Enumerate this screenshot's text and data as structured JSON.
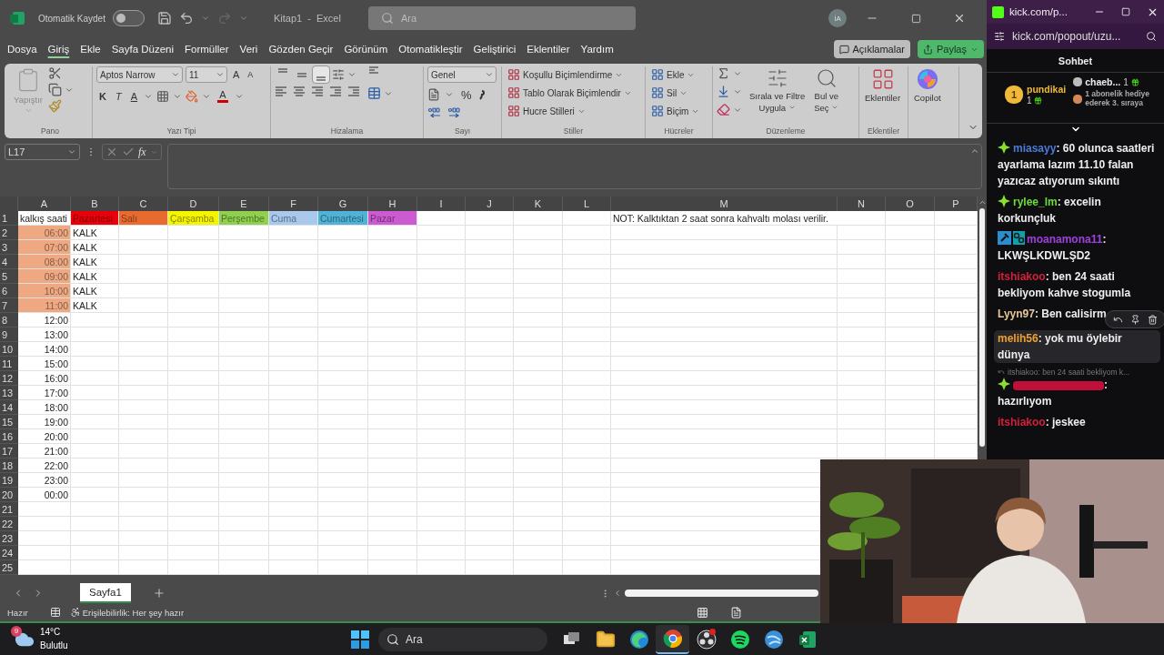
{
  "excel": {
    "title_bar": {
      "autosave_label": "Otomatik Kaydet",
      "autosave_on": false,
      "redo_disabled": true,
      "document_title": "Kitap1  -  Excel",
      "search": {
        "placeholder": "Ara"
      },
      "avatar": "İA"
    },
    "menu": {
      "tabs": [
        {
          "label": "Dosya",
          "selected": false
        },
        {
          "label": "Giriş",
          "selected": true
        },
        {
          "label": "Ekle",
          "selected": false
        },
        {
          "label": "Sayfa Düzeni",
          "selected": false
        },
        {
          "label": "Formüller",
          "selected": false
        },
        {
          "label": "Veri",
          "selected": false
        },
        {
          "label": "Gözden Geçir",
          "selected": false
        },
        {
          "label": "Görünüm",
          "selected": false
        },
        {
          "label": "Otomatikleştir",
          "selected": false
        },
        {
          "label": "Geliştirici",
          "selected": false
        },
        {
          "label": "Eklentiler",
          "selected": false
        },
        {
          "label": "Yardım",
          "selected": false
        }
      ],
      "buttons": [
        {
          "kind": "comments",
          "label": "Açıklamalar"
        },
        {
          "kind": "share",
          "label": "Paylaş"
        }
      ]
    },
    "ribbon": {
      "groups": [
        {
          "kind": "clipboard",
          "name": "Pano",
          "paste": {
            "label": "Yapıştır",
            "disabled": true
          }
        },
        {
          "kind": "font",
          "name": "Yazı Tipi",
          "font": "Aptos Narrow",
          "size": "11",
          "grow": "A",
          "shrink": "A",
          "bold": "K",
          "italic": "T",
          "underline": "A",
          "font_color": "A"
        },
        {
          "kind": "alignment",
          "name": "Hizalama",
          "vertical": [
            {
              "selected": false
            },
            {
              "selected": false
            },
            {
              "selected": true
            }
          ]
        },
        {
          "kind": "number",
          "name": "Sayı",
          "format": "Genel",
          "percent": "%"
        },
        {
          "kind": "styles",
          "name": "Stiller",
          "items": [
            "Koşullu Biçimlendirme",
            "Tablo Olarak Biçimlendir",
            "Hucre Stilleri"
          ]
        },
        {
          "kind": "cells",
          "name": "Hücreler",
          "items": [
            "Ekle",
            "Sil",
            "Biçim"
          ]
        },
        {
          "kind": "editing",
          "name": "Düzenleme",
          "sort": [
            "Sırala ve Filtre",
            "Uygula"
          ],
          "find": [
            "Bul ve",
            "Seç"
          ]
        },
        {
          "kind": "addins",
          "name": "Eklentiler",
          "button": "Eklentiler"
        },
        {
          "kind": "copilot",
          "button": "Copilot"
        }
      ]
    },
    "formula_bar": {
      "name_box": "L17",
      "function_label": "fx"
    },
    "sheet": {
      "columns": [
        "A",
        "B",
        "C",
        "D",
        "E",
        "F",
        "G",
        "H",
        "I",
        "J",
        "K",
        "L",
        "M",
        "N",
        "O",
        "P"
      ],
      "rows": [
        {
          "label": "1",
          "cells": {
            "A": {
              "text": "kalkış saati"
            },
            "B": {
              "text": "Pazartesi",
              "color": "#e8000b"
            },
            "C": {
              "text": "Salı",
              "color": "#e96a2f"
            },
            "D": {
              "text": "Çarşamba",
              "color": "#f5f500"
            },
            "E": {
              "text": "Perşembe",
              "color": "#8fd14f"
            },
            "F": {
              "text": "Cuma",
              "color": "#a8c8ec"
            },
            "G": {
              "text": "Cumartesi",
              "color": "#4fb3d9"
            },
            "H": {
              "text": "Pazar",
              "color": "#cc5ad0"
            },
            "M": {
              "kind": "note",
              "text": "NOT: Kalktıktan 2 saat sonra kahvaltı molası verilir."
            }
          }
        },
        {
          "label": "2",
          "cells": {
            "A": {
              "kind": "time",
              "text": "06:00",
              "color": "#eea882"
            },
            "B": {
              "text": "KALK"
            }
          }
        },
        {
          "label": "3",
          "cells": {
            "A": {
              "kind": "time",
              "text": "07:00",
              "color": "#eea882"
            },
            "B": {
              "text": "KALK"
            }
          }
        },
        {
          "label": "4",
          "cells": {
            "A": {
              "kind": "time",
              "text": "08:00",
              "color": "#eea882"
            },
            "B": {
              "text": "KALK"
            }
          }
        },
        {
          "label": "5",
          "cells": {
            "A": {
              "kind": "time",
              "text": "09:00",
              "color": "#eea882"
            },
            "B": {
              "text": "KALK"
            }
          }
        },
        {
          "label": "6",
          "cells": {
            "A": {
              "kind": "time",
              "text": "10:00",
              "color": "#eea882"
            },
            "B": {
              "text": "KALK"
            }
          }
        },
        {
          "label": "7",
          "cells": {
            "A": {
              "kind": "time",
              "text": "11:00",
              "color": "#eea882"
            },
            "B": {
              "text": "KALK"
            }
          }
        },
        {
          "label": "8",
          "cells": {
            "A": {
              "kind": "time",
              "text": "12:00"
            }
          }
        },
        {
          "label": "9",
          "cells": {
            "A": {
              "kind": "time",
              "text": "13:00"
            }
          }
        },
        {
          "label": "10",
          "cells": {
            "A": {
              "kind": "time",
              "text": "14:00"
            }
          }
        },
        {
          "label": "11",
          "cells": {
            "A": {
              "kind": "time",
              "text": "15:00"
            }
          }
        },
        {
          "label": "12",
          "cells": {
            "A": {
              "kind": "time",
              "text": "16:00"
            }
          }
        },
        {
          "label": "13",
          "cells": {
            "A": {
              "kind": "time",
              "text": "17:00"
            }
          }
        },
        {
          "label": "14",
          "cells": {
            "A": {
              "kind": "time",
              "text": "18:00"
            }
          }
        },
        {
          "label": "15",
          "cells": {
            "A": {
              "kind": "time",
              "text": "19:00"
            }
          }
        },
        {
          "label": "16",
          "cells": {
            "A": {
              "kind": "time",
              "text": "20:00"
            }
          }
        },
        {
          "label": "17",
          "cells": {
            "A": {
              "kind": "time",
              "text": "21:00"
            }
          }
        },
        {
          "label": "18",
          "cells": {
            "A": {
              "kind": "time",
              "text": "22:00"
            }
          }
        },
        {
          "label": "19",
          "cells": {
            "A": {
              "kind": "time",
              "text": "23:00"
            }
          }
        },
        {
          "label": "20",
          "cells": {
            "A": {
              "kind": "time",
              "text": "00:00"
            }
          }
        },
        {
          "label": "21"
        },
        {
          "label": "22"
        },
        {
          "label": "23"
        },
        {
          "label": "24"
        },
        {
          "label": "25"
        }
      ]
    },
    "sheet_tabs": [
      {
        "label": "Sayfa1",
        "selected": true
      }
    ],
    "status_bar": {
      "ready": "Hazır",
      "accessibility": "Erişilebilirlik: Her şey hazır"
    }
  },
  "chat": {
    "window_title": "kick.com/p...",
    "url": "kick.com/popout/uzu...",
    "header": "Sohbet",
    "leaders": [
      {
        "kind": "first",
        "rank": "1",
        "name": "pundikai",
        "count": "1"
      },
      {
        "kind": "second",
        "name": "chaeb...",
        "count": "1"
      },
      {
        "kind": "third",
        "prompt": "1 abonelik hediye ederek 3. sıraya"
      }
    ],
    "messages": [
      {
        "kind": "named",
        "user": "miasayy",
        "color": "#4a7bd8",
        "badges": [
          {
            "kind": "diamond"
          }
        ],
        "text": ": 60 olunca saatleri ayarlama lazım 11.10 falan yazıcaz atıyorum sıkıntı",
        "highlighted": false
      },
      {
        "kind": "named",
        "user": "rylee_lm",
        "color": "#6ddc3a",
        "badges": [
          {
            "kind": "diamond"
          }
        ],
        "text": ": excelin korkunçluk",
        "highlighted": false
      },
      {
        "kind": "named",
        "user": "moanamona11",
        "color": "#a040e0",
        "badges": [
          {
            "kind": "moderator"
          },
          {
            "kind": "og"
          }
        ],
        "text": ": LKWŞLKDWLŞD2",
        "highlighted": false
      },
      {
        "kind": "named",
        "user": "itshiakoo",
        "color": "#d0203a",
        "text": ": ben 24 saati bekliyom kahve stogumla",
        "highlighted": false
      },
      {
        "kind": "named",
        "user": "Lyyn97",
        "color": "#e8c79a",
        "text": ": Ben calisirm",
        "highlighted": false
      },
      {
        "kind": "named",
        "user": "melih56",
        "color": "#f0a030",
        "text": ": yok mu öylebir dünya",
        "highlighted": true
      },
      {
        "kind": "hidden",
        "color": "#c0103a",
        "badges": [
          {
            "kind": "diamond"
          }
        ],
        "reply": "itshiakoo: ben 24 saati bekliyom k...",
        "text": ": hazırlıyom",
        "highlighted": false
      },
      {
        "kind": "named",
        "user": "itshiakoo",
        "color": "#d0203a",
        "text": ": jeskee",
        "highlighted": false
      }
    ]
  },
  "taskbar": {
    "weather": {
      "badge": "9",
      "temperature": "14°C",
      "condition": "Bulutlu"
    },
    "search": {
      "placeholder": "Ara"
    },
    "apps": [
      {
        "kind": "task-view",
        "active": false,
        "notification": false
      },
      {
        "kind": "explorer",
        "active": false,
        "notification": false
      },
      {
        "kind": "edge",
        "active": false,
        "notification": false
      },
      {
        "kind": "chrome",
        "active": true,
        "notification": false
      },
      {
        "kind": "obs",
        "active": false,
        "notification": true
      },
      {
        "kind": "spotify",
        "active": false,
        "notification": false
      },
      {
        "kind": "globe",
        "active": false,
        "notification": false
      },
      {
        "kind": "excel",
        "active": false,
        "notification": false
      }
    ]
  }
}
